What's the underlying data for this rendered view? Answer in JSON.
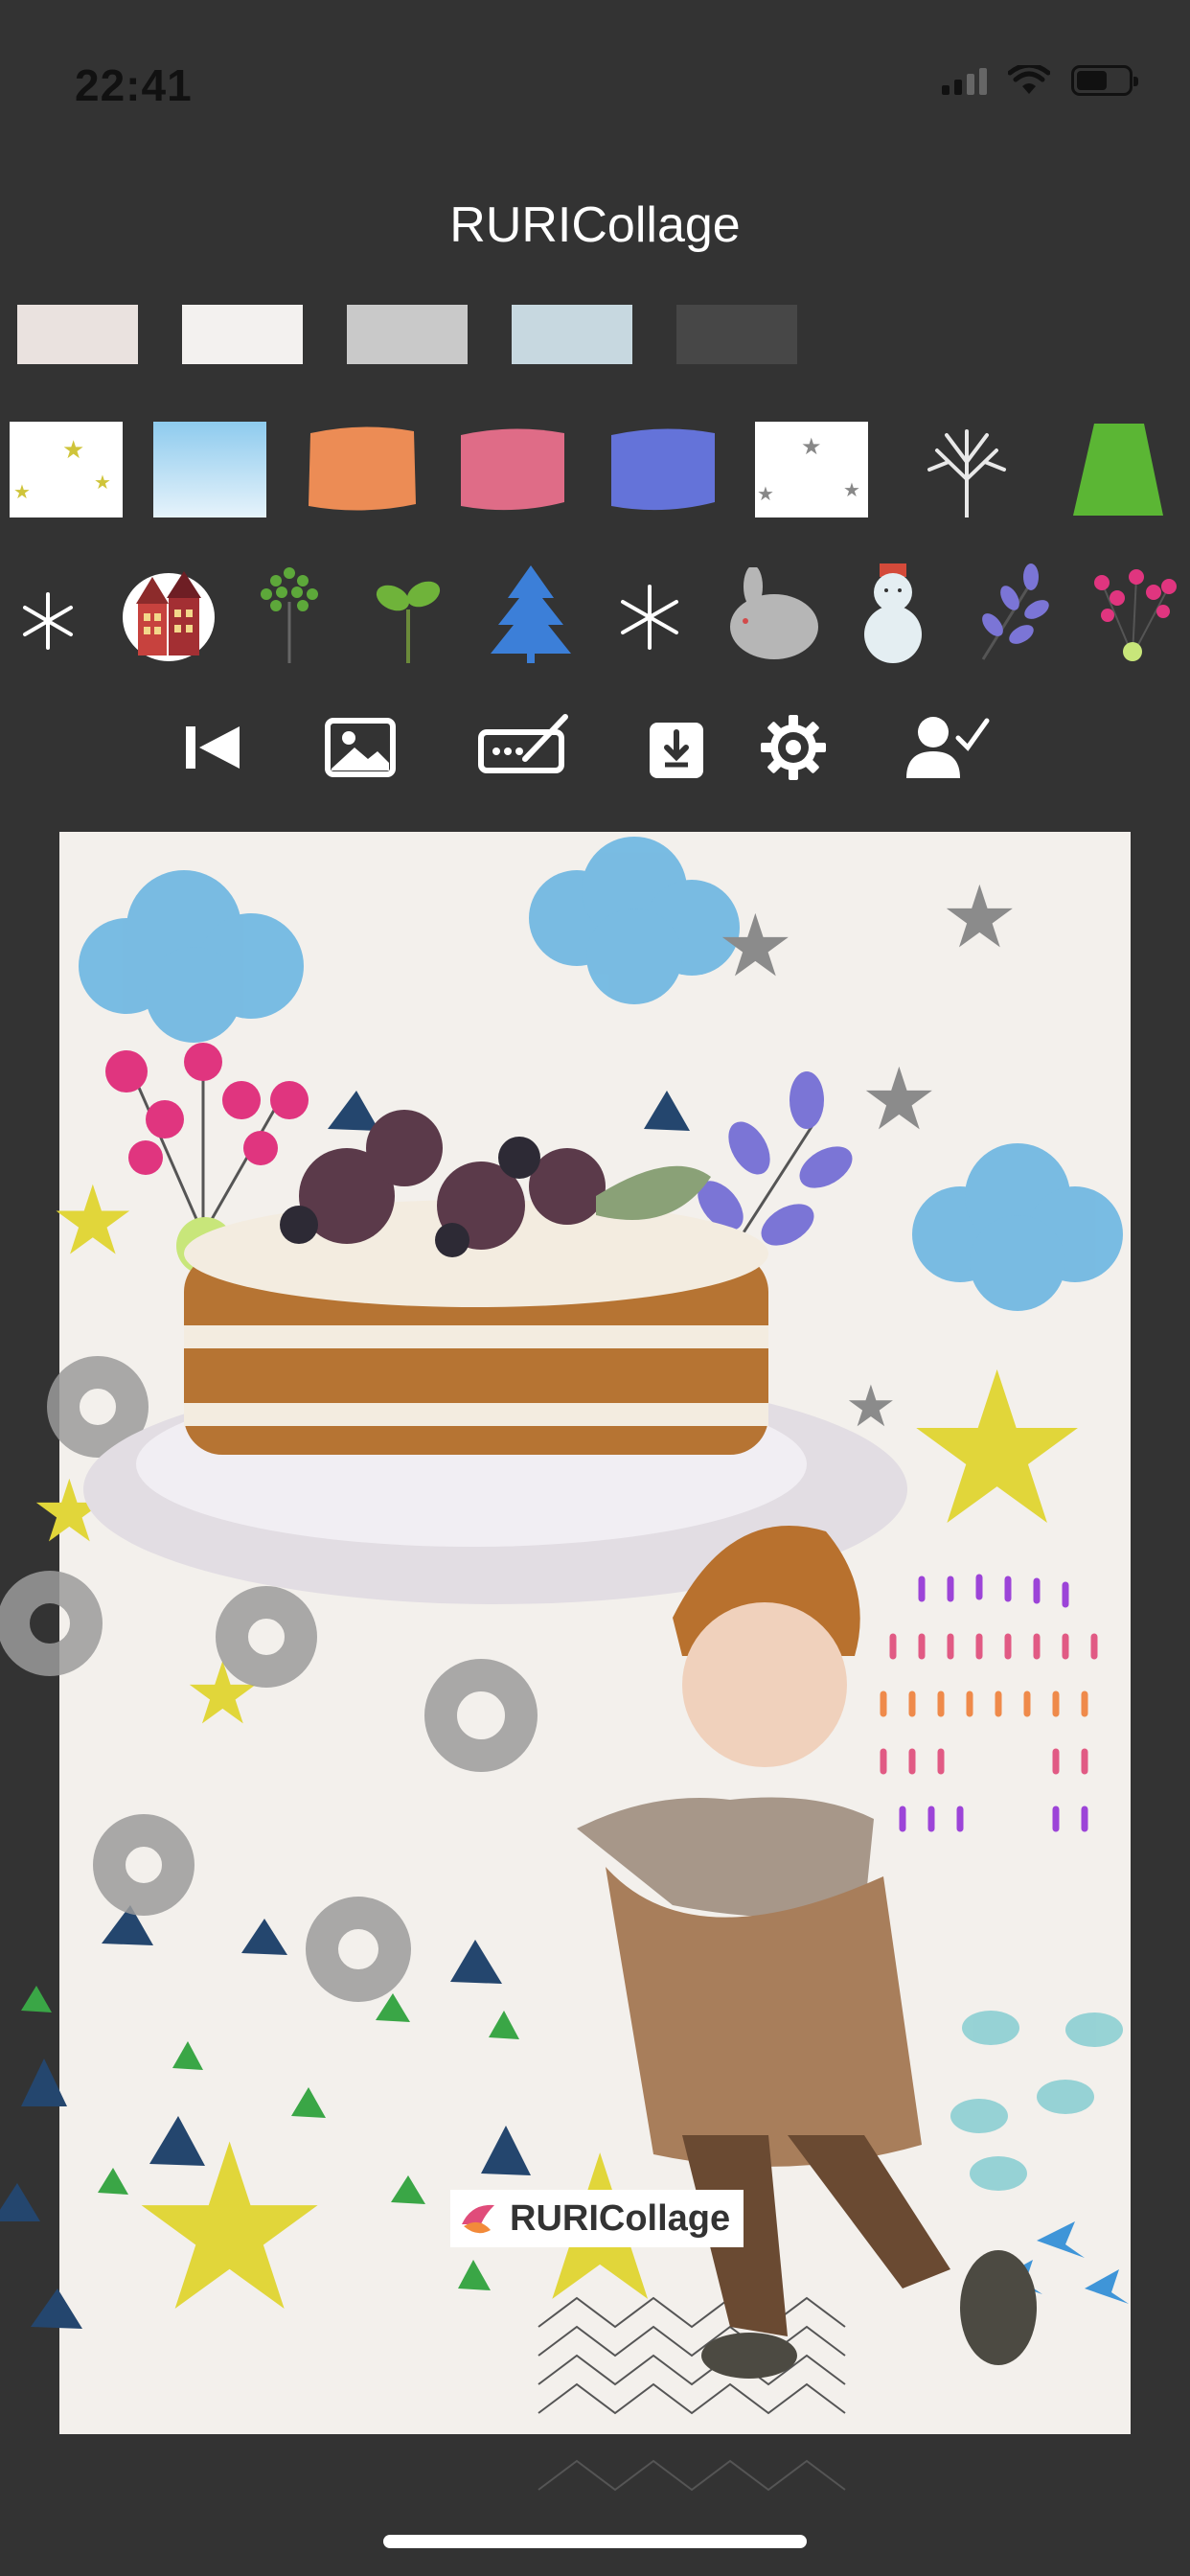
{
  "status_bar": {
    "time": "22:41"
  },
  "header": {
    "title": "RURICollage"
  },
  "paper_swatches": [
    {
      "name": "paper-swatch-pink",
      "color": "#eae2df"
    },
    {
      "name": "paper-swatch-white",
      "color": "#f3f1ef"
    },
    {
      "name": "paper-swatch-gray",
      "color": "#c9c9c9"
    },
    {
      "name": "paper-swatch-blue",
      "color": "#c7d8e0"
    },
    {
      "name": "paper-swatch-dark",
      "color": "#474747"
    }
  ],
  "sticker_swatches": [
    "stars-yellow",
    "sky-gradient",
    "watercolor-orange",
    "watercolor-pink",
    "watercolor-blue",
    "stars-gray",
    "bare-tree",
    "green-trapezoid"
  ],
  "icon_stickers": [
    "snowflake-icon",
    "house-icon",
    "tree-dots-icon",
    "sprout-icon",
    "pine-tree-icon",
    "snowflake-small-icon",
    "rabbit-icon",
    "snowman-icon",
    "leaf-branch-icon",
    "berry-branch-icon"
  ],
  "toolbar": [
    "back-to-start-icon",
    "image-icon",
    "signature-icon",
    "download-icon",
    "settings-icon",
    "user-check-icon"
  ],
  "watermark": {
    "text": "RURICollage"
  },
  "colors": {
    "background": "#333333",
    "canvas": "#f3f0ec",
    "cloud_blue": "#6fb7e0",
    "star_yellow": "#e2d63a",
    "triangle_navy": "#24466e",
    "triangle_green": "#3aa646"
  }
}
